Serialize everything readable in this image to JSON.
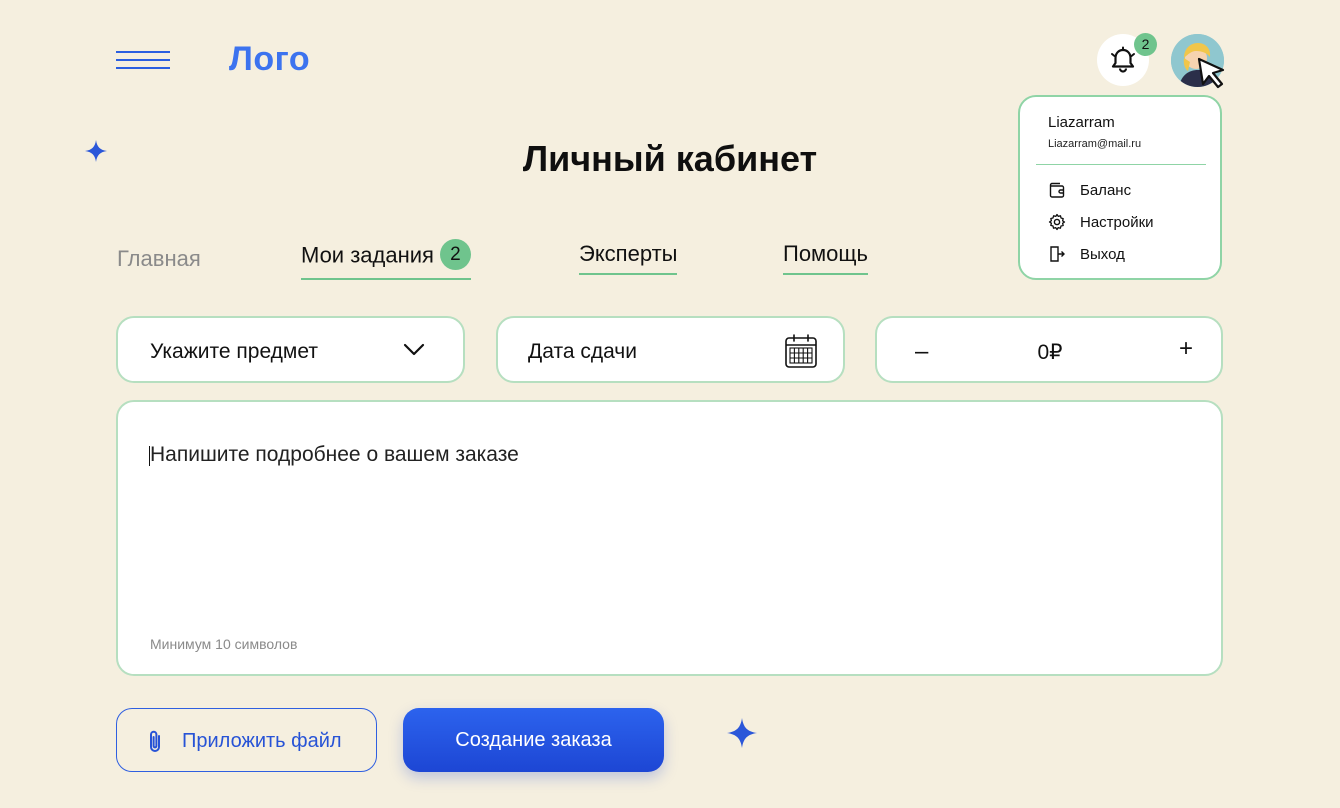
{
  "header": {
    "logo": "Лого",
    "notifications_count": "2"
  },
  "profile_menu": {
    "username": "Liazarram",
    "email": "Liazarram@mail.ru",
    "items": [
      {
        "label": "Баланс",
        "icon": "wallet-icon"
      },
      {
        "label": "Настройки",
        "icon": "gear-icon"
      },
      {
        "label": "Выход",
        "icon": "exit-icon"
      }
    ]
  },
  "page": {
    "title": "Личный кабинет"
  },
  "tabs": [
    {
      "label": "Главная"
    },
    {
      "label": "Мои задания",
      "badge": "2"
    },
    {
      "label": "Эксперты"
    },
    {
      "label": "Помощь"
    }
  ],
  "form": {
    "subject_placeholder": "Укажите предмет",
    "date_placeholder": "Дата сдачи",
    "price_minus": "–",
    "price_value": "0₽",
    "price_plus": "+",
    "description_placeholder": "Напишите подробнее о вашем заказе",
    "description_hint": "Минимум 10 символов",
    "attach_label": "Приложить файл",
    "submit_label": "Создание заказа"
  },
  "colors": {
    "background": "#f5efdf",
    "accent_blue": "#2b5fe0",
    "accent_green": "#6fc48d"
  }
}
